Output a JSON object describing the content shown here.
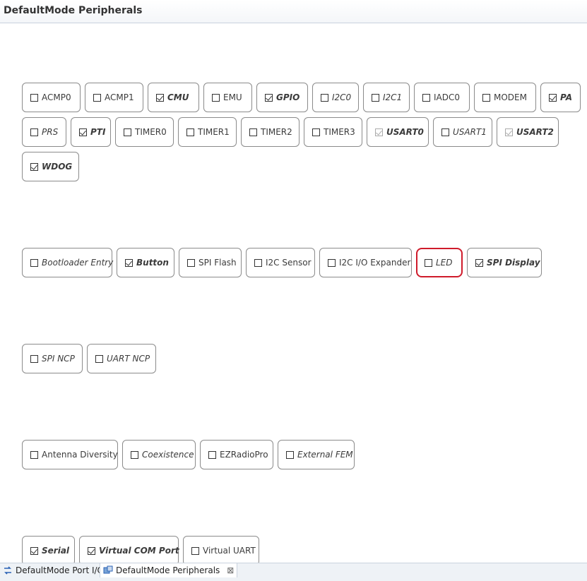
{
  "window": {
    "title": "DefaultMode Peripherals"
  },
  "colors": {
    "selection_border": "#cf1b2b",
    "chip_border": "#8b8b8b"
  },
  "groups": [
    {
      "items": [
        {
          "label": "ACMP0",
          "checked": false,
          "style": "normal",
          "width": 83
        },
        {
          "label": "ACMP1",
          "checked": false,
          "style": "normal",
          "width": 83
        },
        {
          "label": "CMU",
          "checked": true,
          "style": "bold-italic",
          "width": 73
        },
        {
          "label": "EMU",
          "checked": false,
          "style": "normal",
          "width": 69
        },
        {
          "label": "GPIO",
          "checked": true,
          "style": "bold-italic",
          "width": 73
        },
        {
          "label": "I2C0",
          "checked": false,
          "style": "italic",
          "width": 66
        },
        {
          "label": "I2C1",
          "checked": false,
          "style": "italic",
          "width": 66
        },
        {
          "label": "IADC0",
          "checked": false,
          "style": "normal",
          "width": 79
        },
        {
          "label": "MODEM",
          "checked": false,
          "style": "normal",
          "width": 88
        },
        {
          "label": "PA",
          "checked": true,
          "style": "bold-italic",
          "width": 57
        }
      ]
    },
    {
      "items": [
        {
          "label": "PRS",
          "checked": false,
          "style": "italic",
          "width": 63
        },
        {
          "label": "PTI",
          "checked": true,
          "style": "bold-italic",
          "width": 57
        },
        {
          "label": "TIMER0",
          "checked": false,
          "style": "normal",
          "width": 83
        },
        {
          "label": "TIMER1",
          "checked": false,
          "style": "normal",
          "width": 83
        },
        {
          "label": "TIMER2",
          "checked": false,
          "style": "normal",
          "width": 83
        },
        {
          "label": "TIMER3",
          "checked": false,
          "style": "normal",
          "width": 83
        },
        {
          "label": "USART0",
          "checked": true,
          "muted": true,
          "style": "bold-italic",
          "width": 88
        },
        {
          "label": "USART1",
          "checked": false,
          "style": "italic",
          "width": 84
        },
        {
          "label": "USART2",
          "checked": true,
          "muted": true,
          "style": "bold-italic",
          "width": 88
        }
      ]
    },
    {
      "items": [
        {
          "label": "WDOG",
          "checked": true,
          "style": "bold-italic",
          "width": 81
        }
      ]
    },
    {
      "items": [
        {
          "label": "Bootloader Entry",
          "checked": false,
          "style": "italic",
          "width": 128
        },
        {
          "label": "Button",
          "checked": true,
          "style": "bold-italic",
          "width": 82
        },
        {
          "label": "SPI Flash",
          "checked": false,
          "style": "normal",
          "width": 89
        },
        {
          "label": "I2C Sensor",
          "checked": false,
          "style": "normal",
          "width": 98
        },
        {
          "label": "I2C I/O Expander",
          "checked": false,
          "style": "normal",
          "width": 131
        },
        {
          "label": "LED",
          "checked": false,
          "style": "italic",
          "width": 66,
          "selected": true
        },
        {
          "label": "SPI Display",
          "checked": true,
          "style": "bold-italic",
          "width": 106
        }
      ]
    },
    {
      "items": [
        {
          "label": "SPI NCP",
          "checked": false,
          "style": "italic",
          "width": 86
        },
        {
          "label": "UART NCP",
          "checked": false,
          "style": "italic",
          "width": 98
        }
      ]
    },
    {
      "items": [
        {
          "label": "Antenna Diversity",
          "checked": false,
          "style": "normal",
          "width": 136
        },
        {
          "label": "Coexistence",
          "checked": false,
          "style": "italic",
          "width": 104
        },
        {
          "label": "EZRadioPro",
          "checked": false,
          "style": "normal",
          "width": 104
        },
        {
          "label": "External FEM",
          "checked": false,
          "style": "italic",
          "width": 109
        }
      ]
    },
    {
      "items": [
        {
          "label": "Serial",
          "checked": true,
          "style": "bold-italic",
          "width": 75
        },
        {
          "label": "Virtual COM Port",
          "checked": true,
          "style": "bold-italic",
          "width": 141
        },
        {
          "label": "Virtual UART",
          "checked": false,
          "style": "normal",
          "width": 108
        }
      ]
    }
  ],
  "tabs": [
    {
      "label": "DefaultMode Port I/O",
      "active": false,
      "icon": "port-io-icon"
    },
    {
      "label": "DefaultMode Peripherals",
      "active": true,
      "icon": "peripherals-icon",
      "close": "⊠"
    }
  ]
}
